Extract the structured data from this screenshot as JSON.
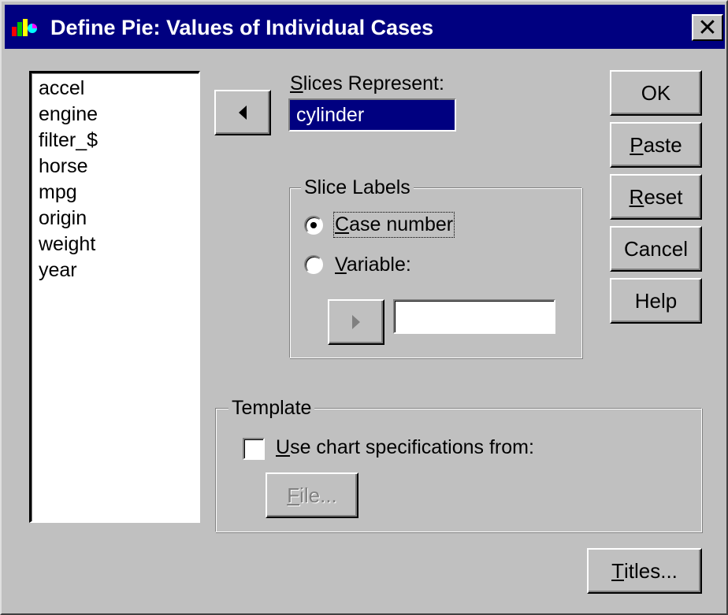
{
  "window": {
    "title": "Define Pie: Values of Individual Cases",
    "close_glyph": "✕",
    "icon": "spss-app-icon"
  },
  "variable_list": {
    "items": [
      "accel",
      "engine",
      "filter_$",
      "horse",
      "mpg",
      "origin",
      "weight",
      "year"
    ]
  },
  "slices_represent": {
    "label": "Slices Represent:",
    "value": "cylinder",
    "transfer_icon": "arrow-left-icon"
  },
  "slice_labels": {
    "legend": "Slice Labels",
    "options": [
      "Case number",
      "Variable:"
    ],
    "selected": "Case number",
    "variable_value": "",
    "transfer_icon": "arrow-right-icon"
  },
  "template": {
    "legend": "Template",
    "checkbox_label": "Use chart specifications from:",
    "checked": false,
    "file_button": "File..."
  },
  "buttons": {
    "ok": "OK",
    "paste": "Paste",
    "reset": "Reset",
    "cancel": "Cancel",
    "help": "Help",
    "titles": "Titles..."
  },
  "colors": {
    "titlebar": "#000080",
    "face": "#c0c0c0",
    "selection": "#000080"
  }
}
